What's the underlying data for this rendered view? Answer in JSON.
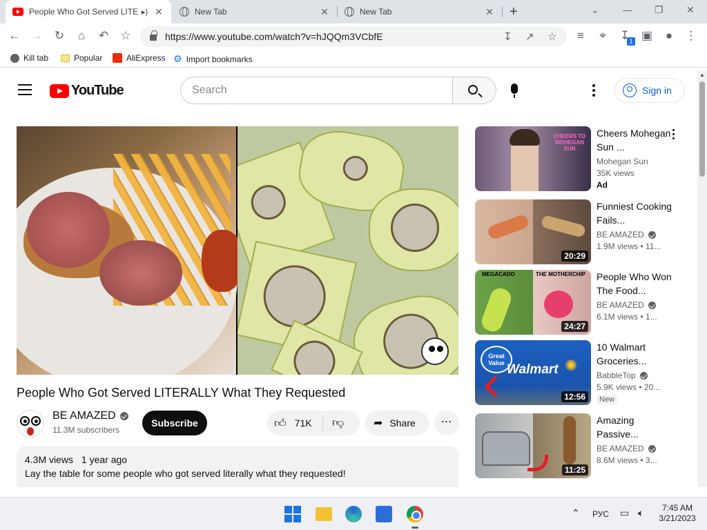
{
  "browser": {
    "tabs": [
      {
        "title": "People Who Got Served LITE",
        "active": true
      },
      {
        "title": "New Tab",
        "active": false
      },
      {
        "title": "New Tab",
        "active": false
      }
    ],
    "url": "https://www.youtube.com/watch?v=hJQQm3VCbfE",
    "download_badge": "1",
    "bookmarks": [
      "Kill tab",
      "Popular",
      "AliExpress",
      "Import bookmarks"
    ]
  },
  "youtube": {
    "logo_text": "YouTube",
    "search_placeholder": "Search",
    "signin_label": "Sign in",
    "video": {
      "title": "People Who Got Served LITERALLY What They Requested",
      "channel": "BE AMAZED",
      "subscribers": "11.3M subscribers",
      "subscribe_label": "Subscribe",
      "likes": "71K",
      "share_label": "Share",
      "views": "4.3M views",
      "age": "1 year ago",
      "description": "Lay the table for some people who got served literally what they requested!"
    },
    "related": [
      {
        "title": "Cheers Mohegan Sun ...",
        "channel": "Mohegan Sun",
        "views": "35K views",
        "badge": "Ad",
        "verified": false,
        "duration": ""
      },
      {
        "title": "Funniest Cooking Fails...",
        "channel": "BE AMAZED",
        "views": "1.9M views",
        "age": "11...",
        "verified": true,
        "duration": "20:29"
      },
      {
        "title": "People Who Won The Food...",
        "channel": "BE AMAZED",
        "views": "6.1M views",
        "age": "1...",
        "verified": true,
        "duration": "24:27"
      },
      {
        "title": "10 Walmart Groceries...",
        "channel": "BabbleTop",
        "views": "5.9K views",
        "age": "20...",
        "badge": "New",
        "verified": true,
        "duration": "12:56"
      },
      {
        "title": "Amazing Passive...",
        "channel": "BE AMAZED",
        "views": "8.6M views",
        "age": "3...",
        "verified": true,
        "duration": "11:25"
      }
    ],
    "thumb_labels": {
      "cheers": "CHEERS TO MOHEGAN SUN",
      "megacado": "MEGACADO",
      "motherchip": "THE MOTHERCHIP",
      "great_value": "Great Value",
      "walmart": "Walmart"
    }
  },
  "taskbar": {
    "language": "РУС",
    "time": "7:45 AM",
    "date": "3/21/2023"
  },
  "colors": {
    "youtube_red": "#ff0000",
    "link_blue": "#065fd4",
    "chrome_tabstrip": "#dfe3e8"
  }
}
